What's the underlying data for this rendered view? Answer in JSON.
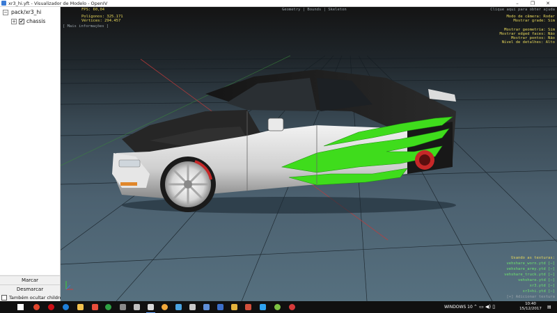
{
  "window": {
    "title": "xr3_hi.yft - Visualizador de Modelo - OpenIV",
    "minimize": "–",
    "maximize": "❐",
    "close": "✕"
  },
  "tree": {
    "root_label": "pack/xr3_hi",
    "root_expander": "−",
    "child_label": "chassis",
    "child_expander": "+",
    "child_checked": "✔"
  },
  "panel": {
    "mark_label": "Marcar",
    "unmark_label": "Desmarcar",
    "hide_children_label": "Também ocultar children"
  },
  "viewport": {
    "fps": "FPS: 60,04",
    "polygons": "Polígonos: 325.171",
    "vertices": "Vértices: 294.457",
    "more_info": "[ Mais informações ]",
    "view_tabs": "Geometry | Bounds | Skeleton",
    "hint": "Clique aqui para obter ajuda",
    "settings": [
      "Modo de câmera: Rodar",
      "Mostrar grade: Sim",
      "",
      "Mostrar geometria: Sim",
      "Mostrar edged faces: Não",
      "Mostrar pontos: Não",
      "Nível de detalhes: Alto"
    ],
    "textures_title": "Usando as texturas:",
    "textures": [
      "vehshare_worn.ytd [−]",
      "vehshare_army.ytd [−]",
      "vehshare_truck.ytd [−]",
      "vehshare.ytd [−]",
      "xr3.ytd [−]",
      "xr3+hi.ytd [−]"
    ],
    "add_texture": "[+] Adicionar textura"
  },
  "taskbar": {
    "apps": [
      {
        "icon": "windows-start-icon",
        "color": "#ffffff"
      },
      {
        "icon": "search-icon",
        "color": "#ffffff"
      },
      {
        "icon": "task-view-icon",
        "color": "#ffffff"
      },
      {
        "icon": "chrome-icon",
        "color": "#e0452c"
      },
      {
        "icon": "opera-icon",
        "color": "#cc0f16"
      },
      {
        "icon": "edge-icon",
        "color": "#1f7fd8"
      },
      {
        "icon": "explorer-icon",
        "color": "#f2c14e"
      },
      {
        "icon": "xbox-icon",
        "color": "#2ea043"
      },
      {
        "icon": "game-icon",
        "color": "#8a8a8a"
      },
      {
        "icon": "steam-icon",
        "color": "#c0c0c0"
      },
      {
        "icon": "openiv-icon",
        "color": "#d9d9d9"
      },
      {
        "icon": "app-icon",
        "color": "#f2a93b"
      },
      {
        "icon": "tool-icon",
        "color": "#4aa3df"
      },
      {
        "icon": "utility-icon",
        "color": "#c9c9c9"
      },
      {
        "icon": "archive-icon",
        "color": "#e3b23c"
      },
      {
        "icon": "image-icon",
        "color": "#d14f3b"
      },
      {
        "icon": "photoshop-icon",
        "color": "#2fa3f0"
      },
      {
        "icon": "browser-icon",
        "color": "#7cc242"
      },
      {
        "icon": "media-icon",
        "color": "#d63a3a"
      }
    ],
    "os_label": "WINDOWS 10",
    "time": "10:40",
    "date": "15/12/2017"
  }
}
